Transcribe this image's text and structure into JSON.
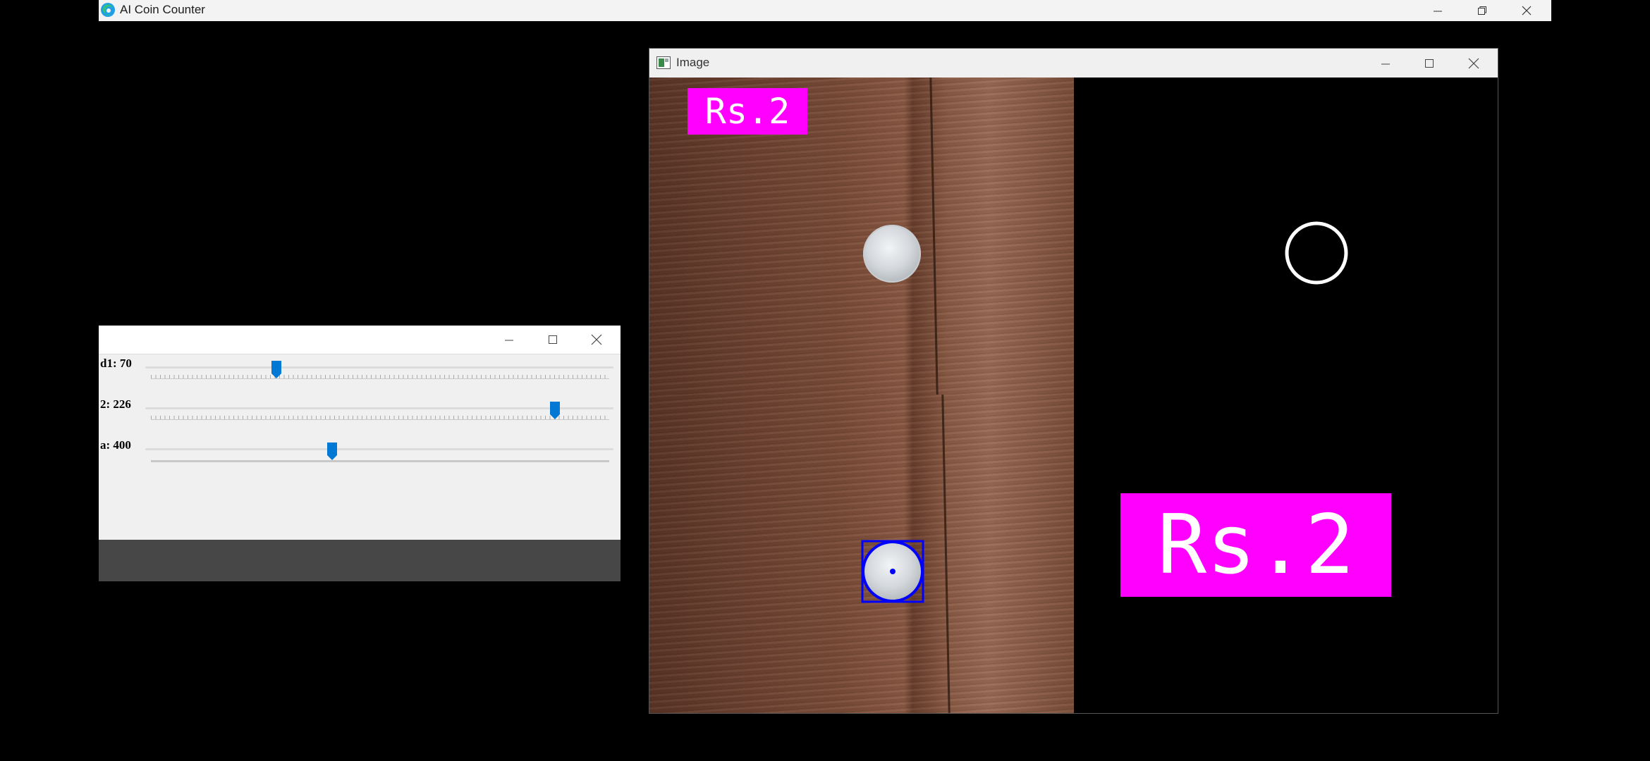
{
  "app": {
    "title": "AI Coin Counter",
    "controls": {
      "minimize": "minimize",
      "restore": "restore",
      "close": "close"
    }
  },
  "trackbar_window": {
    "title": "",
    "trackbars": [
      {
        "label": "d1: 70",
        "value": 70,
        "max": 255
      },
      {
        "label": "2: 226",
        "value": 226,
        "max": 255
      },
      {
        "label": "a: 400",
        "value": 400,
        "max": 1000
      }
    ]
  },
  "image_window": {
    "title": "Image",
    "top_left_label": "Rs.2",
    "big_label": "Rs.2"
  },
  "colors": {
    "label_bg": "#ff00ff",
    "detection_box": "#0000ff",
    "thumb": "#0078d4"
  }
}
